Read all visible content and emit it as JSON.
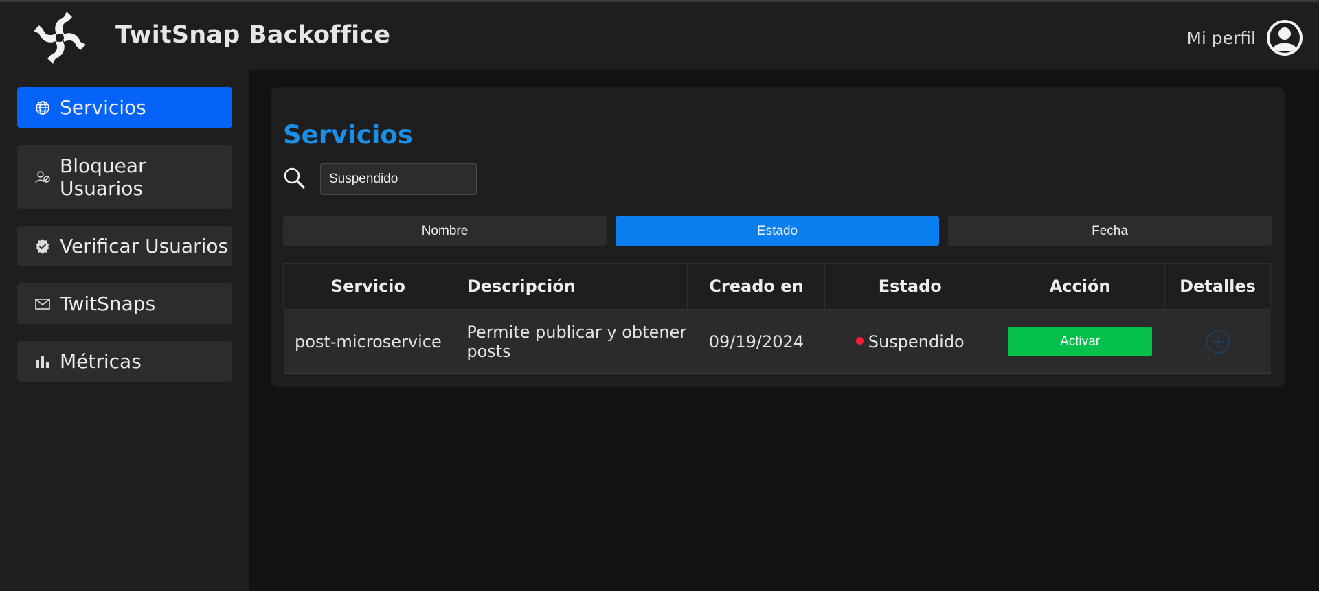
{
  "header": {
    "title": "TwitSnap Backoffice",
    "profile_label": "Mi perfil",
    "logo_icon": "pinwheel-logo-icon",
    "avatar_icon": "user-circle-icon"
  },
  "sidebar": {
    "items": [
      {
        "label": "Servicios",
        "icon": "globe-icon",
        "active": true
      },
      {
        "label": "Bloquear Usuarios",
        "icon": "user-block-icon",
        "active": false
      },
      {
        "label": "Verificar Usuarios",
        "icon": "verified-badge-icon",
        "active": false
      },
      {
        "label": "TwitSnaps",
        "icon": "envelope-icon",
        "active": false
      },
      {
        "label": "Métricas",
        "icon": "bar-chart-icon",
        "active": false
      }
    ]
  },
  "main": {
    "title": "Servicios",
    "search": {
      "value": "Suspendido",
      "icon": "search-icon"
    },
    "filters": [
      {
        "label": "Nombre",
        "active": false
      },
      {
        "label": "Estado",
        "active": true
      },
      {
        "label": "Fecha",
        "active": false
      }
    ],
    "table": {
      "columns": [
        "Servicio",
        "Descripción",
        "Creado en",
        "Estado",
        "Acción",
        "Detalles"
      ],
      "rows": [
        {
          "servicio": "post-microservice",
          "descripcion": "Permite publicar y obtener posts",
          "creado_en": "09/19/2024",
          "estado": "Suspendido",
          "accion": "Activar",
          "detalles_icon": "plus-circle-icon"
        }
      ]
    }
  },
  "colors": {
    "accent": "#0563fa",
    "filter_active": "#0a7ff0",
    "title_blue": "#1a8fe8",
    "status_suspended": "#ff1a3c",
    "action_green": "#06c04c"
  }
}
